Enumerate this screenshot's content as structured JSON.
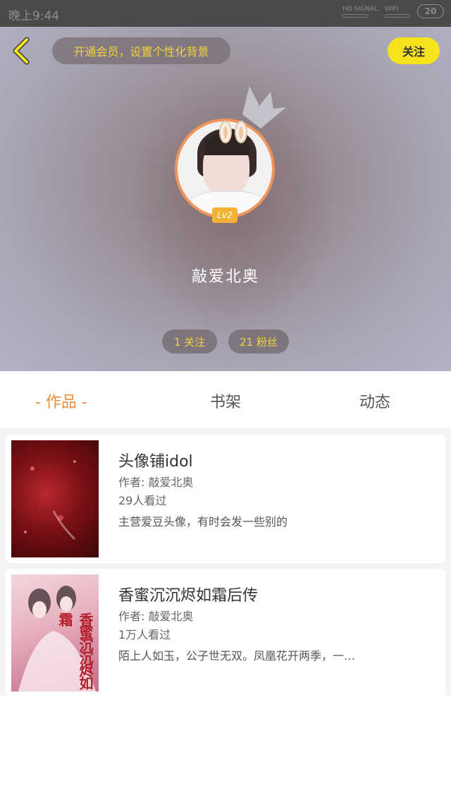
{
  "status_bar": {
    "time": "晚上9:44",
    "signal_label": "HD SIGNAL",
    "wifi_label": "WIFI",
    "battery": "20"
  },
  "header": {
    "vip_promo": "开通会员，设置个性化背景",
    "follow_label": "关注"
  },
  "profile": {
    "level": "Lv2",
    "username": "敲爱北奥",
    "following": "1 关注",
    "fans": "21 粉丝"
  },
  "tabs": [
    {
      "label": "- 作品 -",
      "active": true
    },
    {
      "label": "书架",
      "active": false
    },
    {
      "label": "动态",
      "active": false
    }
  ],
  "works": [
    {
      "title": "头像铺idol",
      "author": "作者: 敲爱北奥",
      "views": "29人看过",
      "description": "主营爱豆头像，有时会发一些别的"
    },
    {
      "title": "香蜜沉沉烬如霜后传",
      "author": "作者: 敲爱北奥",
      "views": "1万人看过",
      "description": "陌上人如玉，公子世无双。凤凰花开两季，一…",
      "cover_text": "香蜜沉沉烬如霜"
    }
  ],
  "colors": {
    "accent_yellow": "#f7e31b",
    "promo_text": "#f3d23a",
    "active_tab": "#f08a3c",
    "avatar_ring": "#f0945a"
  }
}
